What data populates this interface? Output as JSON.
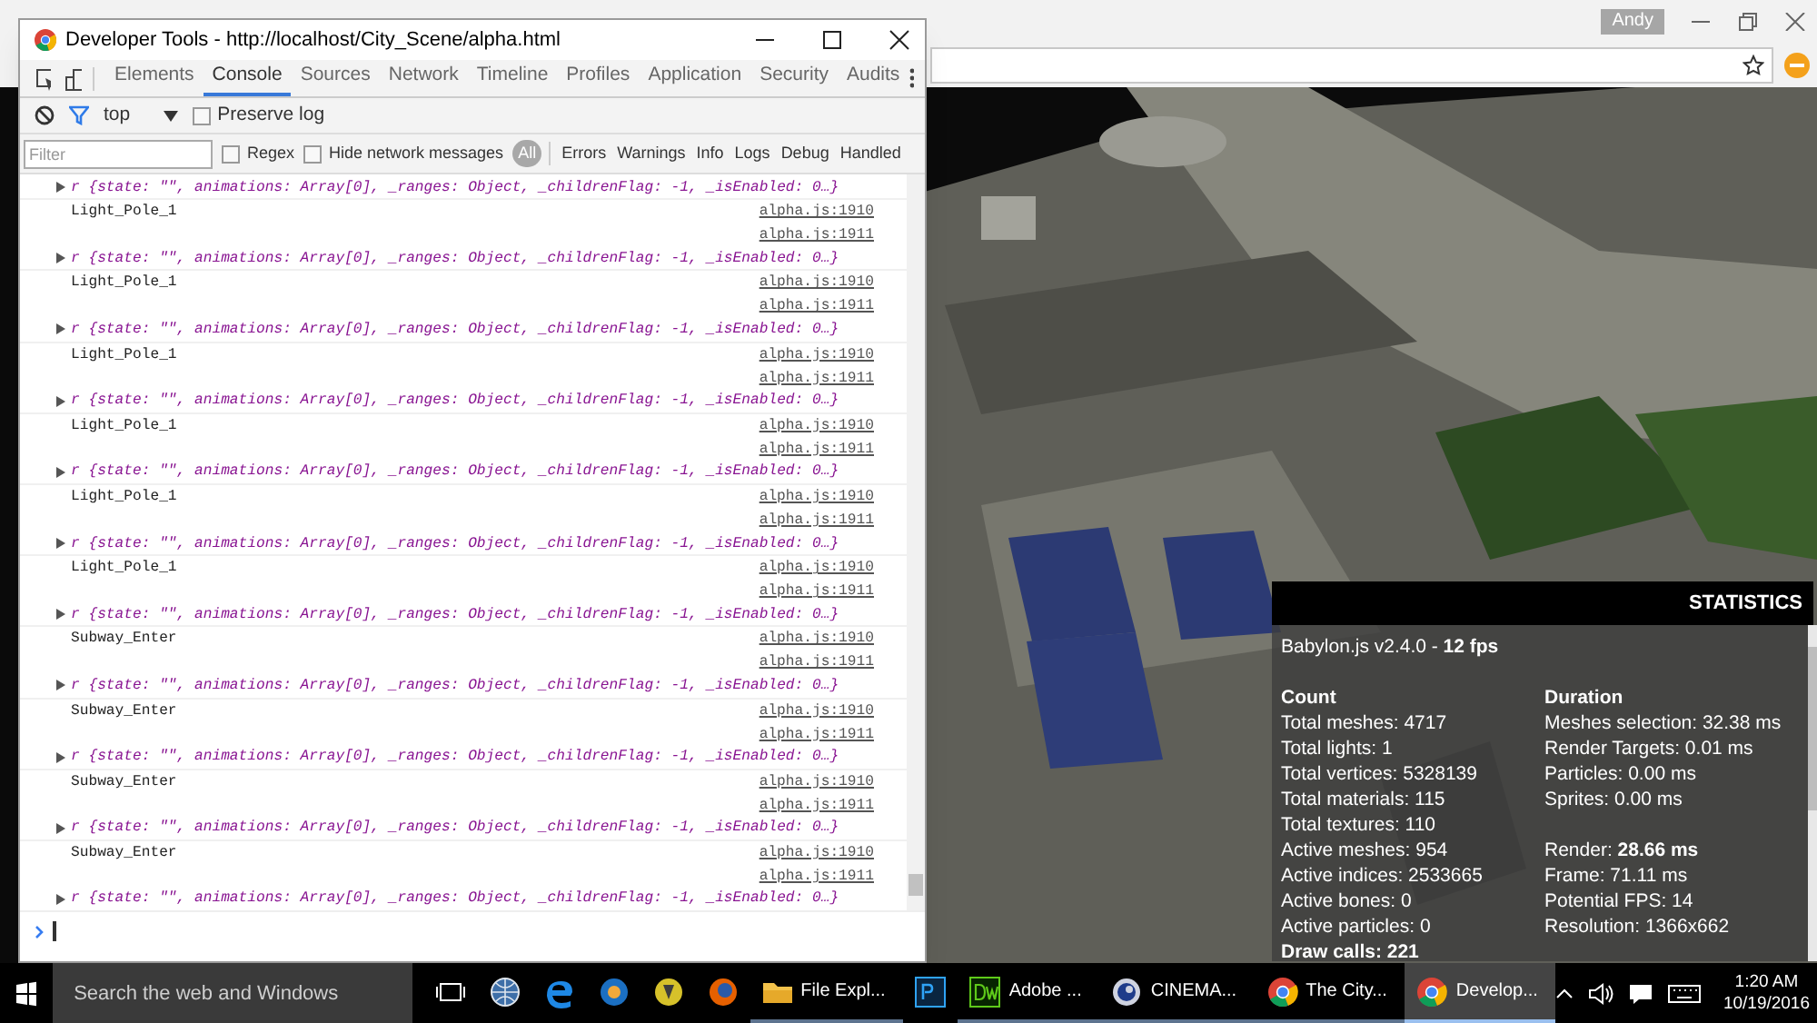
{
  "browser": {
    "profile": "Andy"
  },
  "devtools": {
    "title": "Developer Tools - http://localhost/City_Scene/alpha.html",
    "tabs": [
      {
        "label": "Elements",
        "selected": false
      },
      {
        "label": "Console",
        "selected": true
      },
      {
        "label": "Sources",
        "selected": false
      },
      {
        "label": "Network",
        "selected": false
      },
      {
        "label": "Timeline",
        "selected": false
      },
      {
        "label": "Profiles",
        "selected": false
      },
      {
        "label": "Application",
        "selected": false
      },
      {
        "label": "Security",
        "selected": false
      },
      {
        "label": "Audits",
        "selected": false
      }
    ],
    "context": "top",
    "preserve_log": {
      "label": "Preserve log",
      "checked": false
    },
    "filter": {
      "placeholder": "Filter"
    },
    "regex": {
      "label": "Regex",
      "checked": false
    },
    "hide_network": {
      "label": "Hide network messages",
      "checked": false
    },
    "levels": [
      {
        "label": "All",
        "selected": true
      },
      {
        "label": "Errors",
        "selected": false
      },
      {
        "label": "Warnings",
        "selected": false
      },
      {
        "label": "Info",
        "selected": false
      },
      {
        "label": "Logs",
        "selected": false
      },
      {
        "label": "Debug",
        "selected": false
      },
      {
        "label": "Handled",
        "selected": false
      }
    ],
    "entries": [
      {
        "kind": "object",
        "text": "r {state: \"\", animations: Array[0], _ranges: Object, _childrenFlag: -1, _isEnabled: 0…}"
      },
      {
        "kind": "log",
        "text": "Light_Pole_1",
        "source": "alpha.js:1910"
      },
      {
        "kind": "source",
        "source": "alpha.js:1911"
      },
      {
        "kind": "object",
        "text": "r {state: \"\", animations: Array[0], _ranges: Object, _childrenFlag: -1, _isEnabled: 0…}"
      },
      {
        "kind": "log",
        "text": "Light_Pole_1",
        "source": "alpha.js:1910"
      },
      {
        "kind": "source",
        "source": "alpha.js:1911"
      },
      {
        "kind": "object",
        "text": "r {state: \"\", animations: Array[0], _ranges: Object, _childrenFlag: -1, _isEnabled: 0…}"
      },
      {
        "kind": "log",
        "text": "Light_Pole_1",
        "source": "alpha.js:1910"
      },
      {
        "kind": "source",
        "source": "alpha.js:1911"
      },
      {
        "kind": "object",
        "text": "r {state: \"\", animations: Array[0], _ranges: Object, _childrenFlag: -1, _isEnabled: 0…}"
      },
      {
        "kind": "log",
        "text": "Light_Pole_1",
        "source": "alpha.js:1910"
      },
      {
        "kind": "source",
        "source": "alpha.js:1911"
      },
      {
        "kind": "object",
        "text": "r {state: \"\", animations: Array[0], _ranges: Object, _childrenFlag: -1, _isEnabled: 0…}"
      },
      {
        "kind": "log",
        "text": "Light_Pole_1",
        "source": "alpha.js:1910"
      },
      {
        "kind": "source",
        "source": "alpha.js:1911"
      },
      {
        "kind": "object",
        "text": "r {state: \"\", animations: Array[0], _ranges: Object, _childrenFlag: -1, _isEnabled: 0…}"
      },
      {
        "kind": "log",
        "text": "Light_Pole_1",
        "source": "alpha.js:1910"
      },
      {
        "kind": "source",
        "source": "alpha.js:1911"
      },
      {
        "kind": "object",
        "text": "r {state: \"\", animations: Array[0], _ranges: Object, _childrenFlag: -1, _isEnabled: 0…}"
      },
      {
        "kind": "log",
        "text": "Subway_Enter",
        "source": "alpha.js:1910"
      },
      {
        "kind": "source",
        "source": "alpha.js:1911"
      },
      {
        "kind": "object",
        "text": "r {state: \"\", animations: Array[0], _ranges: Object, _childrenFlag: -1, _isEnabled: 0…}"
      },
      {
        "kind": "log",
        "text": "Subway_Enter",
        "source": "alpha.js:1910"
      },
      {
        "kind": "source",
        "source": "alpha.js:1911"
      },
      {
        "kind": "object",
        "text": "r {state: \"\", animations: Array[0], _ranges: Object, _childrenFlag: -1, _isEnabled: 0…}"
      },
      {
        "kind": "log",
        "text": "Subway_Enter",
        "source": "alpha.js:1910"
      },
      {
        "kind": "source",
        "source": "alpha.js:1911"
      },
      {
        "kind": "object",
        "text": "r {state: \"\", animations: Array[0], _ranges: Object, _childrenFlag: -1, _isEnabled: 0…}"
      },
      {
        "kind": "log",
        "text": "Subway_Enter",
        "source": "alpha.js:1910"
      },
      {
        "kind": "source",
        "source": "alpha.js:1911"
      },
      {
        "kind": "object",
        "text": "r {state: \"\", animations: Array[0], _ranges: Object, _childrenFlag: -1, _isEnabled: 0…}"
      }
    ]
  },
  "statistics": {
    "title": "STATISTICS",
    "version": "Babylon.js v2.4.0 - **12 fps**",
    "columns": [
      {
        "heading": "Count",
        "sections": [
          [
            "Total meshes: 4717",
            "Total lights: 1",
            "Total vertices: 5328139",
            "Total materials: 115",
            "Total textures: 110",
            "Active meshes: 954",
            "Active indices: 2533665",
            "Active bones: 0",
            "Active particles: 0",
            "**Draw calls: 221**"
          ]
        ]
      },
      {
        "heading": "Duration",
        "sections": [
          [
            "Meshes selection: 32.38 ms",
            "Render Targets: 0.01 ms",
            "Particles: 0.00 ms",
            "Sprites: 0.00 ms"
          ],
          [
            "Render: **28.66 ms**",
            "Frame: 71.11 ms",
            "Potential FPS: 14",
            "Resolution: 1366x662"
          ]
        ]
      }
    ]
  },
  "taskbar": {
    "search": {
      "placeholder": "Search the web and Windows"
    },
    "apps": [
      {
        "kind": "taskview",
        "selected": false
      },
      {
        "kind": "globe",
        "selected": false
      },
      {
        "kind": "edge",
        "selected": false
      },
      {
        "kind": "bluecircle",
        "selected": false
      },
      {
        "kind": "yellowcircle",
        "selected": false
      },
      {
        "kind": "firefox",
        "selected": false
      },
      {
        "kind": "folder",
        "label": "File Expl...",
        "selected": false
      },
      {
        "kind": "ps",
        "selected": false
      },
      {
        "kind": "dw",
        "label": "Adobe ...",
        "selected": false
      },
      {
        "kind": "cinema",
        "label": "CINEMA...",
        "selected": false
      },
      {
        "kind": "chrome",
        "label": "The City...",
        "selected": false
      },
      {
        "kind": "chrome",
        "label": "Develop...",
        "selected": true
      }
    ],
    "time": "1:20 AM",
    "date": "10/19/2016"
  }
}
